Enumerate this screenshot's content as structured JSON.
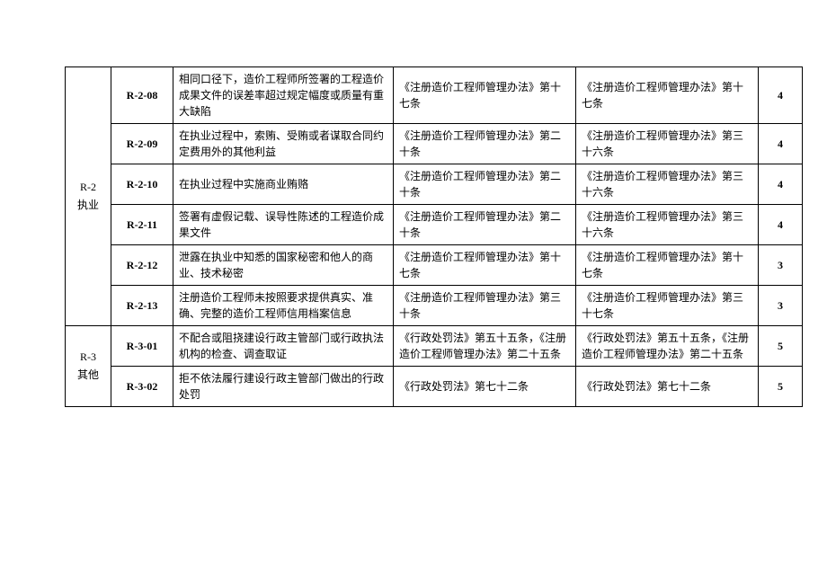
{
  "groups": [
    {
      "category_code": "R-2",
      "category_name": "执业",
      "rows": [
        {
          "code": "R-2-08",
          "desc": "相同口径下，造价工程师所签署的工程造价成果文件的误差率超过规定幅度或质量有重大缺陷",
          "basis1": "《注册造价工程师管理办法》第十七条",
          "basis2": "《注册造价工程师管理办法》第十七条",
          "score": "4"
        },
        {
          "code": "R-2-09",
          "desc": "在执业过程中，索贿、受贿或者谋取合同约定费用外的其他利益",
          "basis1": "《注册造价工程师管理办法》第二十条",
          "basis2": "《注册造价工程师管理办法》第三十六条",
          "score": "4"
        },
        {
          "code": "R-2-10",
          "desc": "在执业过程中实施商业贿赂",
          "basis1": "《注册造价工程师管理办法》第二十条",
          "basis2": "《注册造价工程师管理办法》第三十六条",
          "score": "4"
        },
        {
          "code": "R-2-11",
          "desc": "签署有虚假记载、误导性陈述的工程造价成果文件",
          "basis1": "《注册造价工程师管理办法》第二十条",
          "basis2": "《注册造价工程师管理办法》第三十六条",
          "score": "4"
        },
        {
          "code": "R-2-12",
          "desc": "泄露在执业中知悉的国家秘密和他人的商业、技术秘密",
          "basis1": "《注册造价工程师管理办法》第十七条",
          "basis2": "《注册造价工程师管理办法》第十七条",
          "score": "3"
        },
        {
          "code": "R-2-13",
          "desc": "注册造价工程师未按照要求提供真实、准确、完整的造价工程师信用档案信息",
          "basis1": "《注册造价工程师管理办法》第三十条",
          "basis2": "《注册造价工程师管理办法》第三十七条",
          "score": "3"
        }
      ]
    },
    {
      "category_code": "R-3",
      "category_name": "其他",
      "rows": [
        {
          "code": "R-3-01",
          "desc": "不配合或阻挠建设行政主管部门或行政执法机构的检查、调查取证",
          "basis1": "《行政处罚法》第五十五条，《注册造价工程师管理办法》第二十五条",
          "basis2": "《行政处罚法》第五十五条，《注册造价工程师管理办法》第二十五条",
          "score": "5"
        },
        {
          "code": "R-3-02",
          "desc": "拒不依法履行建设行政主管部门做出的行政处罚",
          "basis1": "《行政处罚法》第七十二条",
          "basis2": "《行政处罚法》第七十二条",
          "score": "5"
        }
      ]
    }
  ]
}
